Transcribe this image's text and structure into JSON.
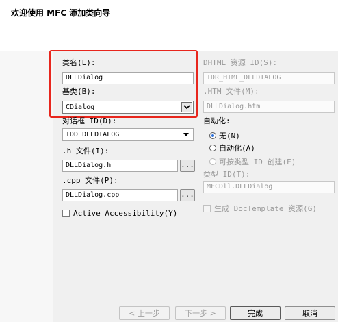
{
  "header": {
    "title": "欢迎使用 MFC 添加类向导"
  },
  "left": {
    "class_name_label": "类名(L):",
    "class_name_value": "DLLDialog",
    "base_class_label": "基类(B):",
    "base_class_value": "CDialog",
    "dialog_id_label": "对话框 ID(D):",
    "dialog_id_value": "IDD_DLLDIALOG",
    "h_file_label": ".h 文件(I):",
    "h_file_value": "DLLDialog.h",
    "h_browse": "...",
    "cpp_file_label": ".cpp 文件(P):",
    "cpp_file_value": "DLLDialog.cpp",
    "cpp_browse": "...",
    "accessibility_label": "Active Accessibility(Y)"
  },
  "right": {
    "dhtml_label": "DHTML 资源 ID(S):",
    "dhtml_value": "IDR_HTML_DLLDIALOG",
    "htm_label": ".HTM 文件(M):",
    "htm_value": "DLLDialog.htm",
    "automation_label": "自动化:",
    "radio_none": "无(N)",
    "radio_automation": "自动化(A)",
    "radio_creatable": "可按类型 ID 创建(E)",
    "type_id_label": "类型 ID(T):",
    "type_id_value": "MFCDll.DLLDialog",
    "doctemplate_label": "生成 DocTemplate 资源(G)"
  },
  "buttons": {
    "back": "< 上一步",
    "next": "下一步 >",
    "finish": "完成",
    "cancel": "取消"
  },
  "colors": {
    "highlight": "#e8261d",
    "radio_accent": "#2a6ed8"
  }
}
